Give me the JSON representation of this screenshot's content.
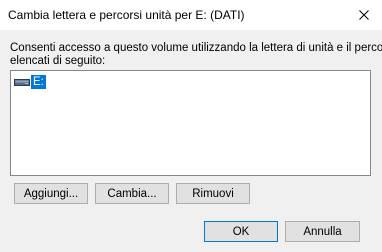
{
  "window": {
    "title": "Cambia lettera e percorsi unità per E: (DATI)"
  },
  "description": {
    "line1": "Consenti accesso a questo volume utilizzando la lettera di unità e il percorso",
    "line2": "elencati di seguito:"
  },
  "drive_list": {
    "items": [
      {
        "label": "E:",
        "icon": "drive-icon",
        "selected": true
      }
    ]
  },
  "buttons": {
    "add": "Aggiungi...",
    "change": "Cambia...",
    "remove": "Rimuovi",
    "ok": "OK",
    "cancel": "Annulla"
  },
  "colors": {
    "selection": "#0078d7",
    "background": "#f0f0f0",
    "button_face": "#e1e1e1"
  }
}
